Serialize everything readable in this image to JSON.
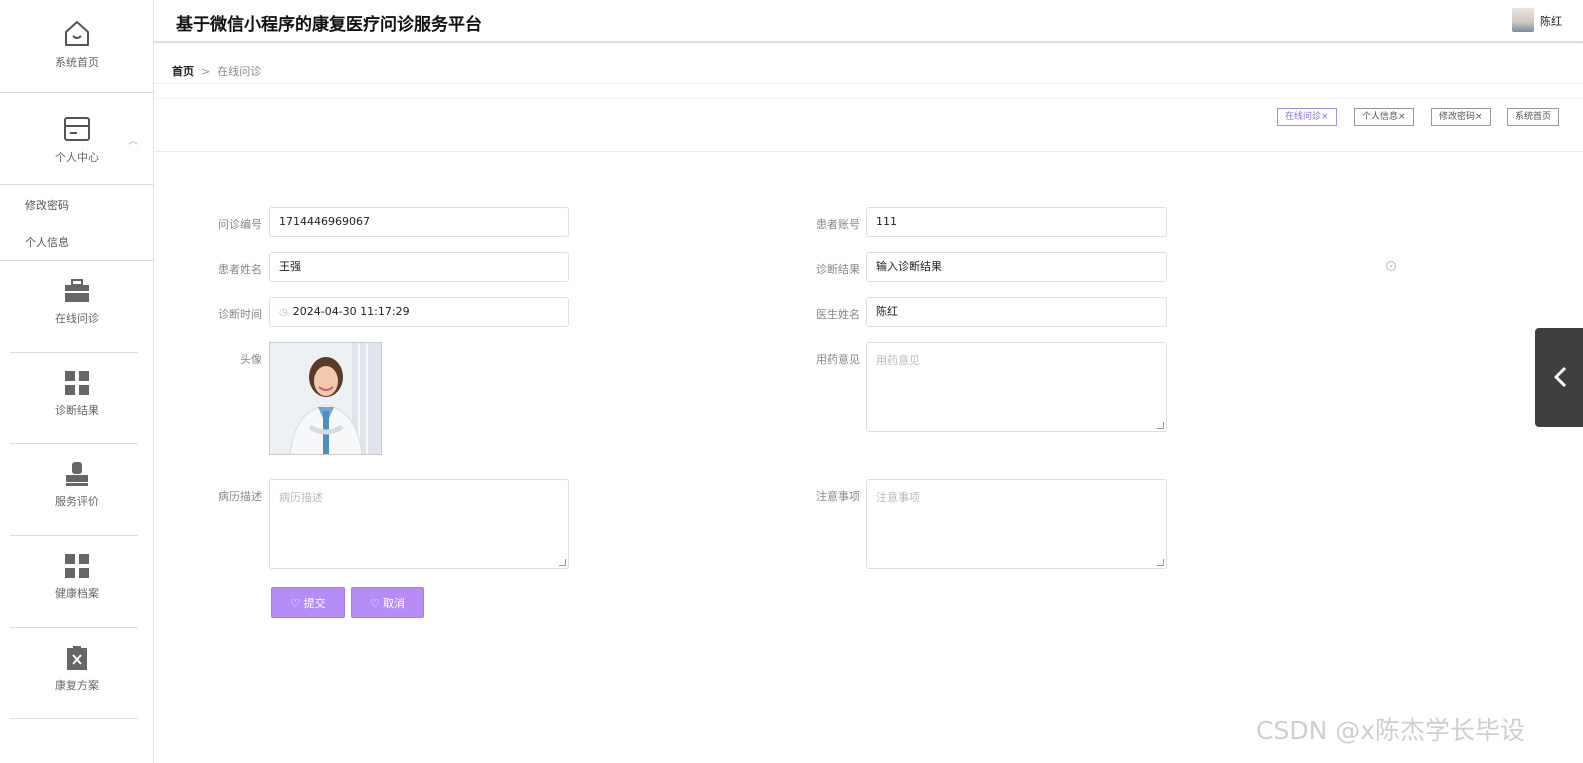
{
  "app": {
    "title": "基于微信小程序的康复医疗问诊服务平台"
  },
  "user": {
    "name": "陈红"
  },
  "sidebar": {
    "items": [
      {
        "label": "系统首页",
        "icon": "home-icon"
      },
      {
        "label": "个人中心",
        "icon": "card-icon"
      },
      {
        "label": "在线问诊",
        "icon": "briefcase-icon"
      },
      {
        "label": "诊断结果",
        "icon": "grid-icon"
      },
      {
        "label": "服务评价",
        "icon": "stamp-icon"
      },
      {
        "label": "健康档案",
        "icon": "grid-icon"
      },
      {
        "label": "康复方案",
        "icon": "clipboard-x-icon"
      }
    ],
    "sub_items": [
      "修改密码",
      "个人信息"
    ]
  },
  "breadcrumb": {
    "home": "首页",
    "separator": ">",
    "current": "在线问诊"
  },
  "tabs": [
    {
      "label": "在线问诊",
      "close": "×",
      "active": true
    },
    {
      "label": "个人信息",
      "close": "×"
    },
    {
      "label": "修改密码",
      "close": "×"
    },
    {
      "label": "系统首页"
    }
  ],
  "form": {
    "consult_no": {
      "label": "问诊编号",
      "value": "1714446969067"
    },
    "patient_account": {
      "label": "患者账号",
      "value": "111"
    },
    "patient_name": {
      "label": "患者姓名",
      "value": "王强"
    },
    "diagnosis_result": {
      "label": "诊断结果",
      "value": "输入诊断结果"
    },
    "consult_time": {
      "label": "诊断时间",
      "value": "2024-04-30 11:17:29"
    },
    "doctor_name": {
      "label": "医生姓名",
      "value": "陈红"
    },
    "avatar": {
      "label": "头像"
    },
    "medication": {
      "label": "用药意见",
      "placeholder": "用药意见"
    },
    "history": {
      "label": "病历描述",
      "placeholder": "病历描述"
    },
    "notes": {
      "label": "注意事项",
      "placeholder": "注意事项"
    }
  },
  "buttons": {
    "submit": "提交",
    "cancel": "取消"
  },
  "watermark": "CSDN @x陈杰学长毕设",
  "colors": {
    "accent": "#b68cf6",
    "tab_active": "#8a6bdc"
  }
}
